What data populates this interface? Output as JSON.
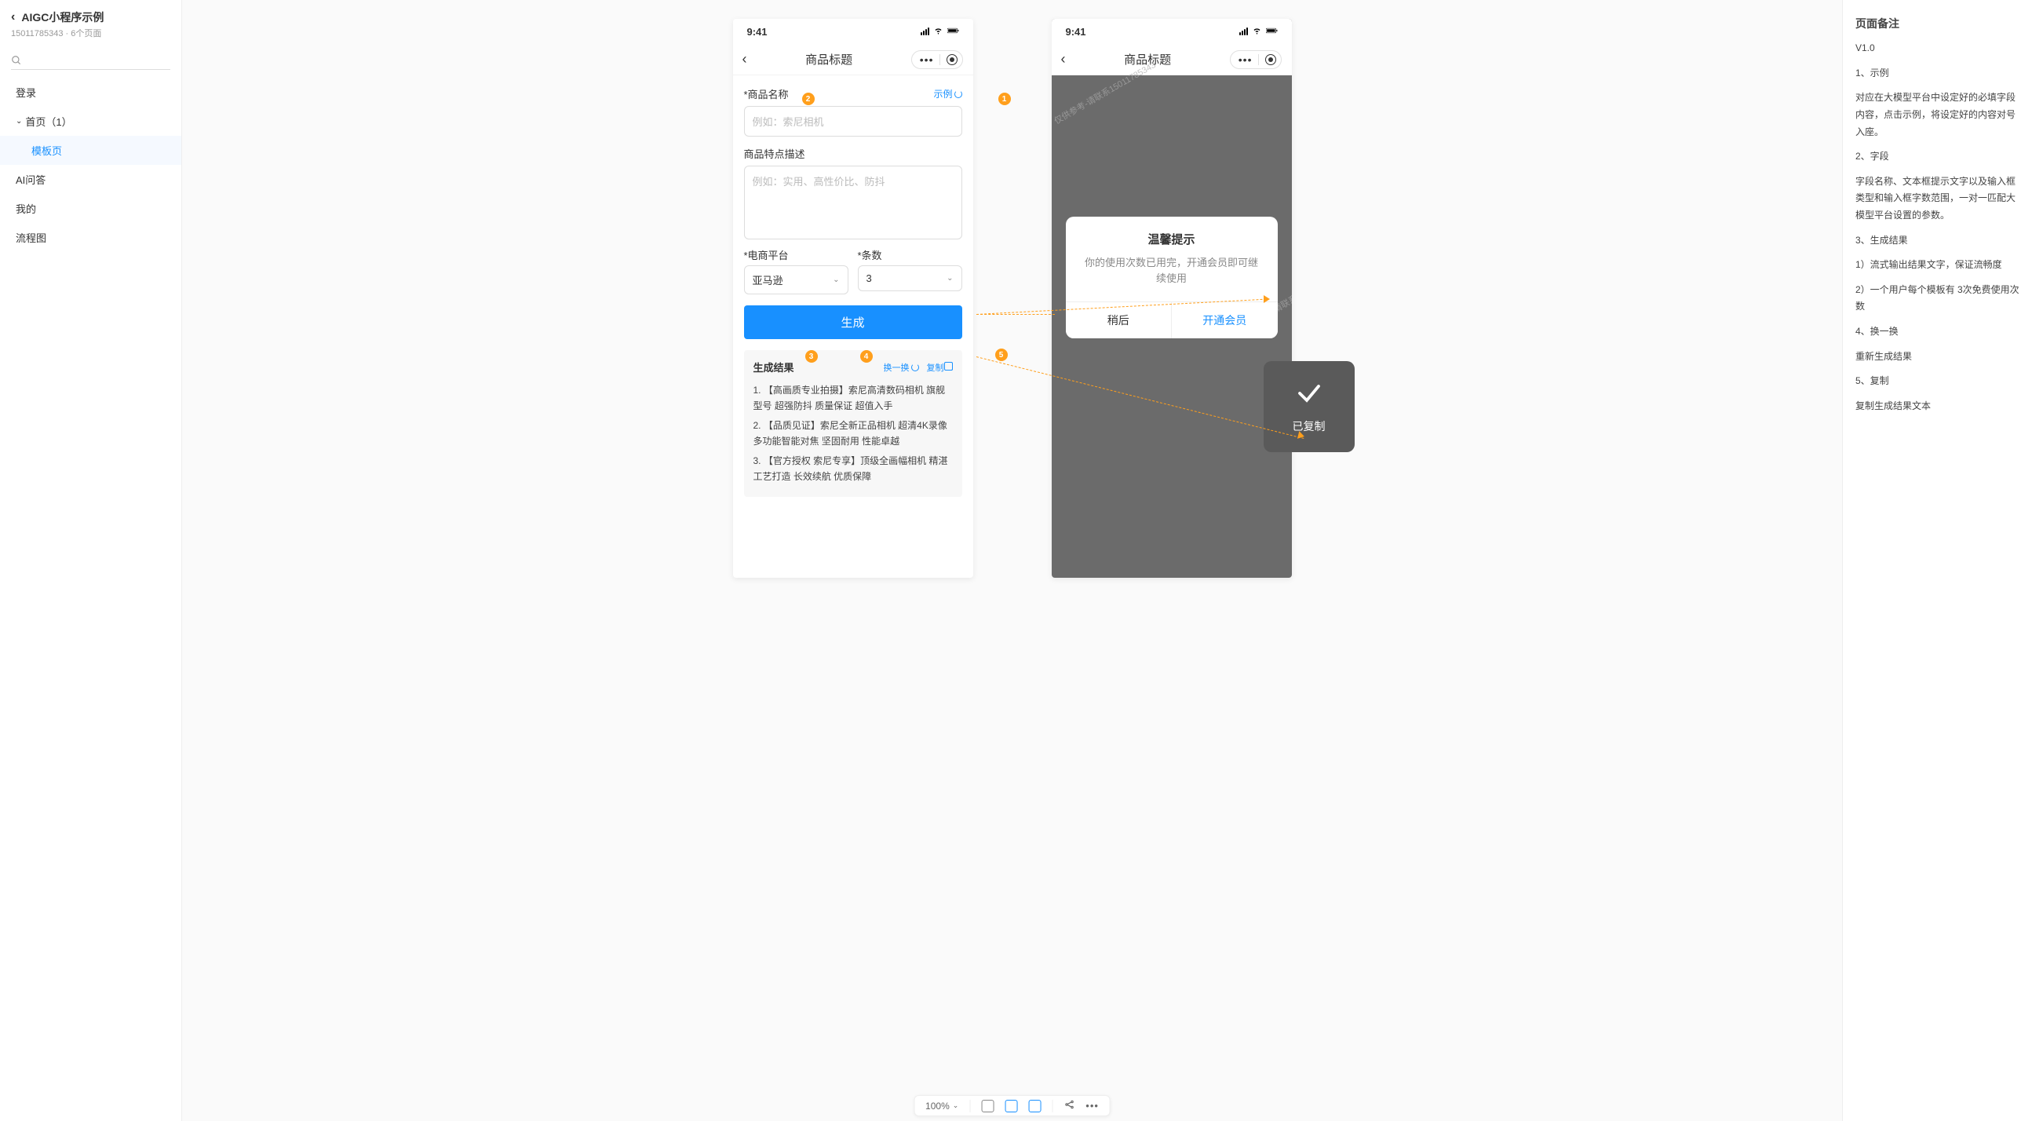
{
  "sidebar": {
    "title": "AIGC小程序示例",
    "subtitle": "15011785343 · 6个页面",
    "items": [
      {
        "label": "登录"
      },
      {
        "label": "首页（1）",
        "count": ""
      },
      {
        "label": "模板页",
        "active": true
      },
      {
        "label": "AI问答"
      },
      {
        "label": "我的"
      },
      {
        "label": "流程图"
      }
    ]
  },
  "phone1": {
    "time": "9:41",
    "nav_title": "商品标题",
    "field_name_label": "*商品名称",
    "example_link": "示例",
    "name_placeholder": "例如：索尼相机",
    "desc_label": "商品特点描述",
    "desc_placeholder": "例如：实用、高性价比、防抖",
    "platform_label": "*电商平台",
    "platform_value": "亚马逊",
    "count_label": "*条数",
    "count_value": "3",
    "gen_btn": "生成",
    "result_title": "生成结果",
    "shuffle": "换一换",
    "copy": "复制",
    "result_lines": [
      "1. 【高画质专业拍摄】索尼高清数码相机 旗舰型号 超强防抖 质量保证 超值入手",
      "2. 【品质见证】索尼全新正品相机 超清4K录像 多功能智能对焦 坚固耐用 性能卓越",
      "3. 【官方授权 索尼专享】顶级全画幅相机 精湛工艺打造 长效续航 优质保障"
    ]
  },
  "phone2": {
    "time": "9:41",
    "nav_title": "商品标题",
    "modal_title": "温馨提示",
    "modal_msg": "你的使用次数已用完，开通会员即可继续使用",
    "btn_later": "稍后",
    "btn_open": "开通会员",
    "watermark": "仅供参考-请联系15011785343"
  },
  "toast": {
    "text": "已复制"
  },
  "notes": {
    "title": "页面备注",
    "version": "V1.0",
    "lines": [
      "1、示例",
      "对应在大模型平台中设定好的必填字段内容，点击示例，将设定好的内容对号入座。",
      "2、字段",
      "字段名称、文本框提示文字以及输入框类型和输入框字数范围，一对一匹配大模型平台设置的参数。",
      "3、生成结果",
      "1）流式输出结果文字，保证流畅度",
      "2）一个用户每个模板有 3次免费使用次数",
      "4、换一换",
      "重新生成结果",
      "5、复制",
      "复制生成结果文本"
    ]
  },
  "bottombar": {
    "zoom": "100%"
  },
  "badges": [
    "1",
    "2",
    "3",
    "4",
    "5"
  ]
}
